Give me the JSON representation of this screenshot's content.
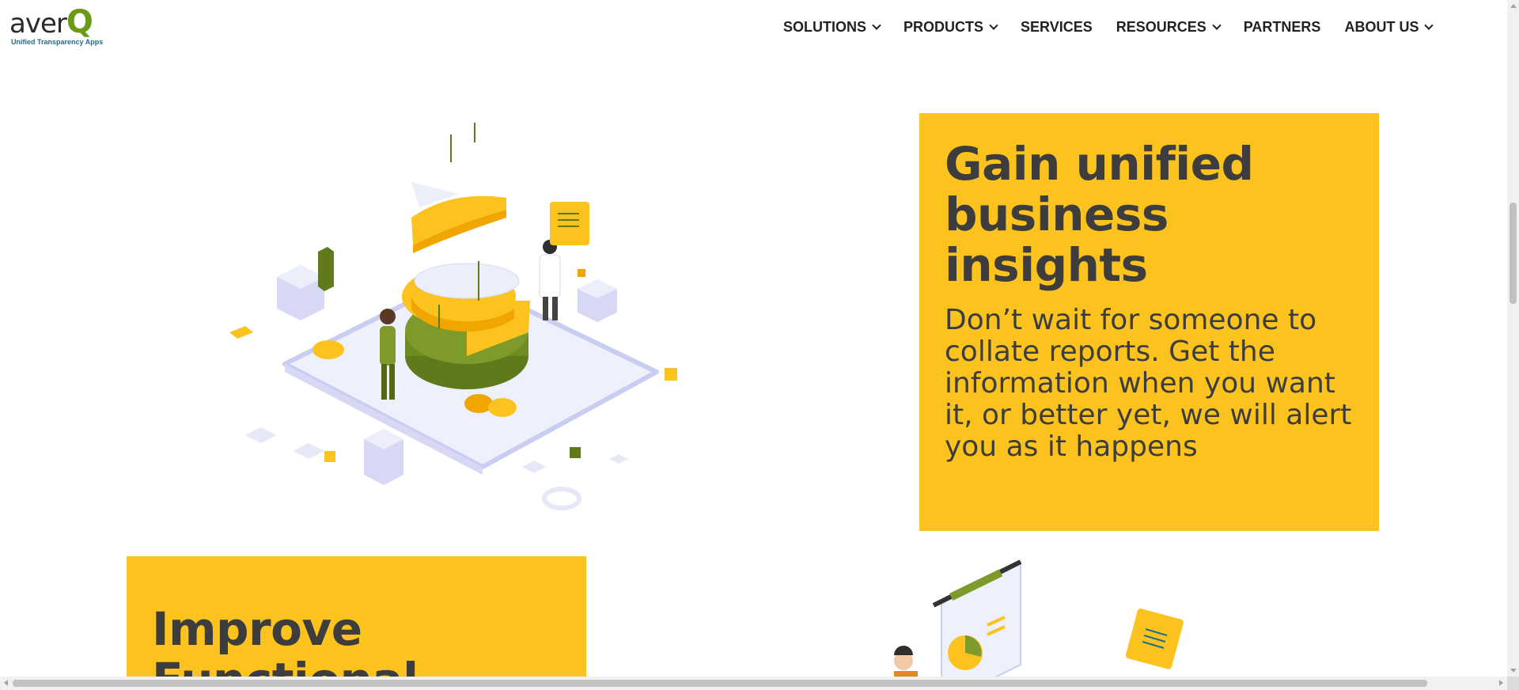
{
  "brand": {
    "logo_text": "aver",
    "logo_q": "Q",
    "tagline": "Unified Transparency Apps"
  },
  "nav": {
    "items": [
      {
        "label": "SOLUTIONS",
        "dropdown": true
      },
      {
        "label": "PRODUCTS",
        "dropdown": true
      },
      {
        "label": "SERVICES",
        "dropdown": false
      },
      {
        "label": "RESOURCES",
        "dropdown": true
      },
      {
        "label": "PARTNERS",
        "dropdown": false
      },
      {
        "label": "ABOUT US",
        "dropdown": true
      }
    ]
  },
  "section1": {
    "title": "Gain unified business insights",
    "body": "Don’t wait for someone to collate reports. Get the information when you want it, or better yet, we will alert you as it happens",
    "illustration": "analytics-pie-chart-illustration"
  },
  "section2": {
    "title": "Improve Functional",
    "illustration": "presentation-board-illustration"
  },
  "colors": {
    "accent_yellow": "#fcc31e",
    "brand_green": "#6a9a16",
    "text_dark": "#3d3d3d",
    "olive": "#5f7a1a",
    "lavender": "#d7d9f4"
  }
}
